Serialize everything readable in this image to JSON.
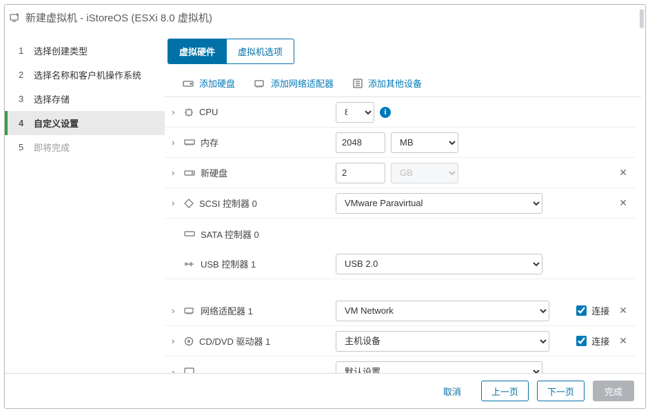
{
  "title": "新建虚拟机 - iStoreOS (ESXi 8.0 虚拟机)",
  "steps": [
    {
      "num": "1",
      "label": "选择创建类型"
    },
    {
      "num": "2",
      "label": "选择名称和客户机操作系统"
    },
    {
      "num": "3",
      "label": "选择存储"
    },
    {
      "num": "4",
      "label": "自定义设置"
    },
    {
      "num": "5",
      "label": "即将完成"
    }
  ],
  "tabs": {
    "hw": "虚拟硬件",
    "opts": "虚拟机选项"
  },
  "toolbar": {
    "add_disk": "添加硬盘",
    "add_nic": "添加网络适配器",
    "add_other": "添加其他设备"
  },
  "rows": {
    "cpu": {
      "label": "CPU",
      "value": "8"
    },
    "memory": {
      "label": "内存",
      "value": "2048",
      "unit": "MB"
    },
    "newdisk": {
      "label": "新硬盘",
      "value": "2",
      "unit": "GB"
    },
    "scsi": {
      "label": "SCSI 控制器 0",
      "value": "VMware Paravirtual"
    },
    "sata": {
      "label": "SATA 控制器 0"
    },
    "usb": {
      "label": "USB 控制器 1",
      "value": "USB 2.0"
    },
    "nic": {
      "label": "网络适配器 1",
      "value": "VM Network",
      "connect": "连接"
    },
    "cd": {
      "label": "CD/DVD 驱动器 1",
      "value": "主机设备",
      "connect": "连接"
    },
    "video": {
      "value": "默认设置"
    }
  },
  "footer": {
    "cancel": "取消",
    "prev": "上一页",
    "next": "下一页",
    "finish": "完成"
  }
}
